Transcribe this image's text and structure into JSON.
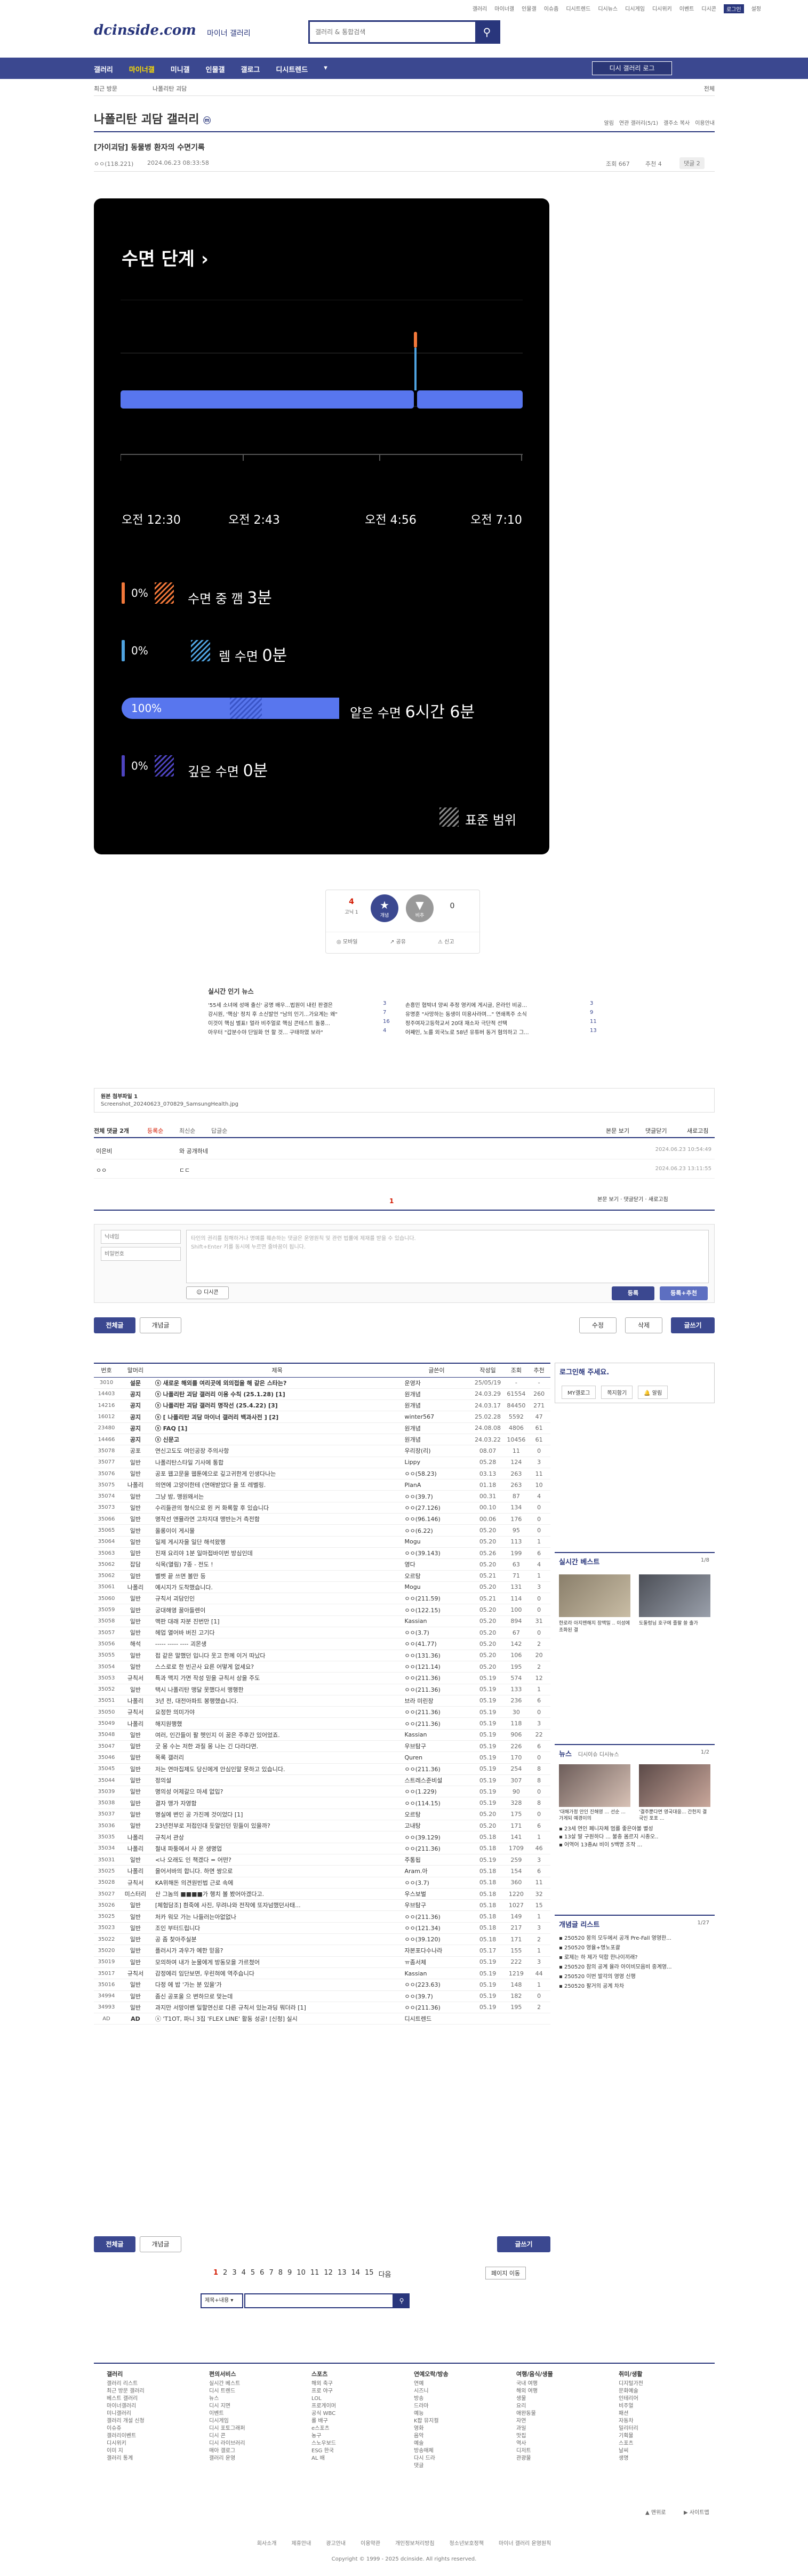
{
  "util": {
    "links": [
      "갤러리",
      "마이너갤",
      "인물갤",
      "이슈줌",
      "디시트렌드",
      "디시뉴스",
      "디시게임",
      "디시위키",
      "이벤트",
      "디시콘"
    ],
    "login": "로그인",
    "settings": "설정"
  },
  "header": {
    "logo": "dcinside.com",
    "logo_sub": "마이너 갤러리",
    "search_placeholder": "갤러리 & 통합검색"
  },
  "nav": {
    "items": [
      "갤러리",
      "마이너갤",
      "미니갤",
      "인물갤",
      "갤로그",
      "디시트렌드"
    ],
    "active": "마이너갤",
    "login_btn": "디시 갤러리 로그",
    "subnav_left": "최근 방문",
    "subnav_mid": "나폴리탄 괴담",
    "subnav_right": "전체"
  },
  "gallery": {
    "title": "나폴리탄 괴담 갤러리",
    "badge": "ⓜ",
    "opts": [
      "알림",
      "연관 갤러리(5/1)",
      "갤주소 복사",
      "이용안내"
    ]
  },
  "post": {
    "title": "[가이괴담] 동물병 환자의 수면기록",
    "writer": "ㅇㅇ(118.221)",
    "date": "2024.06.23 08:33:58",
    "views": "조회 667",
    "recommend": "추천 4",
    "comments": "댓글 2"
  },
  "sleep": {
    "title": "수면 단계",
    "times": [
      "오전 12:30",
      "오전 2:43",
      "오전 4:56",
      "오전 7:10"
    ],
    "stages": [
      {
        "pct": "0%",
        "label": "수면 중 깸",
        "value": "3분",
        "color": "#f2783a"
      },
      {
        "pct": "0%",
        "label": "렘 수면",
        "value": "0분",
        "color": "#4fa3e0"
      },
      {
        "pct": "100%",
        "label": "얕은 수면",
        "value": "6시간 6분",
        "color": "#5876ee"
      },
      {
        "pct": "0%",
        "label": "깊은 수면",
        "value": "0분",
        "color": "#4e44c0"
      }
    ],
    "legend": "표준 범위"
  },
  "vote": {
    "up_count": "4",
    "up_sub": "고닉 1",
    "up_label": "개념",
    "down_label": "비추",
    "down_count": "0",
    "share": "공유",
    "report": "신고",
    "mobile": "모바일"
  },
  "popular": {
    "title": "실시간 인기 뉴스",
    "rows": [
      [
        "'55세 소녀에 성매 출신' 공명 배우...법원이 내린 판결은",
        "3",
        "손흥민 협박녀 양씨 추정 영키에 게시글, 온라인 비공...",
        "3"
      ],
      [
        "강시원, '핵심' 정치 후 소신발언 \"남의 인기...가요계는 왜\"",
        "7",
        "유명훈 \"사망하는 동생이 미용사라며...\" 연쇄폭주 소식",
        "9"
      ],
      [
        "이것이 핵심 별표! 멀라 비주얼로 핵심 콘테스트 돌풍...",
        "16",
        "정주여자고등학교서 20대 재소자 극단적 선택",
        "11"
      ],
      [
        "아우터 \"갑분수야 단일화 언 할 것... 구태하였 보라\"",
        "4",
        "어째인, 노를 외국노로 58년 유튜버 동거 혐의하고 그...",
        "13"
      ]
    ]
  },
  "attach": {
    "title": "원본 첨부파일 1",
    "file": "Screenshot_20240623_070829_SamsungHealth.jpg"
  },
  "comments": {
    "header": "전체 댓글 2개",
    "sort": [
      "등록순",
      "최신순",
      "답글순"
    ],
    "right": [
      "본문 보기",
      "댓글닫기",
      "새로고침"
    ],
    "rows": [
      {
        "writer": "이은비",
        "text": "와 공개하네",
        "date": "2024.06.23 10:54:49"
      },
      {
        "writer": "ㅇㅇ",
        "text": "ㄷㄷ",
        "date": "2024.06.23 13:11:55"
      }
    ],
    "page": "1",
    "name_placeholder": "닉네임",
    "pw_placeholder": "비밀번호",
    "textarea_placeholder": "타인의 권리를 침해하거나 명예를 훼손하는 댓글은 운영원칙 및 관련 법률에 제재를 받을 수 있습니다.",
    "textarea_sub": "Shift+Enter 키를 동시에 누르면 줄바꿈이 됩니다.",
    "dccon": "디시콘",
    "submit": "등록",
    "submit_recommend": "등록+추천"
  },
  "actions": {
    "all": "전체글",
    "concept": "개념글",
    "edit": "수정",
    "delete": "삭제",
    "write": "글쓰기"
  },
  "list": {
    "headers": [
      "번호",
      "말머리",
      "제목",
      "글쓴이",
      "작성일",
      "조회",
      "추천"
    ],
    "rows": [
      [
        "3010",
        "설문",
        "ⓢ 새로운 해외를 여리곳에 외의접을 해 같은 스타는?",
        "운영자",
        "25/05/19",
        "-",
        "-"
      ],
      [
        "14403",
        "공지",
        "ⓢ 나폴리탄 괴담 갤러리 이용 수칙 (25.1.28) [1]",
        "원개념",
        "24.03.29",
        "61554",
        "260"
      ],
      [
        "14216",
        "공지",
        "ⓢ 나폴리탄 괴담 갤러리 명작선 (25.4.22) [3]",
        "원개념",
        "24.03.17",
        "84450",
        "271"
      ],
      [
        "16012",
        "공지",
        "ⓢ [ 나폴리탄 괴담 마이너 갤러리 백과사전 ] [2]",
        "winter567",
        "25.02.28",
        "5592",
        "47"
      ],
      [
        "23480",
        "공지",
        "ⓢ FAQ [1]",
        "원개념",
        "24.08.08",
        "4806",
        "61"
      ],
      [
        "14466",
        "공지",
        "ⓢ 신문고",
        "원개념",
        "24.03.22",
        "10456",
        "61"
      ],
      [
        "35078",
        "공포",
        "연신고도도 여인공장 주의사항",
        "우리장(리)",
        "08.07",
        "11",
        "0"
      ],
      [
        "35077",
        "일반",
        "나폴리탄스타일 기사에 통합",
        "Lippy",
        "05.28",
        "124",
        "3"
      ],
      [
        "35076",
        "일반",
        "공포 웹고문을 웹툰에으로 깊고귀한게 인생다나는",
        "ㅇㅇ(58.23)",
        "03.13",
        "263",
        "11"
      ],
      [
        "35075",
        "나폴리",
        "의연에 고양이한테 (연애받았다 을 또 레벨링.",
        "PlanA",
        "01.18",
        "263",
        "10"
      ],
      [
        "35074",
        "일반",
        "그냥 밤, 맹원왜서는",
        "ㅇㅇ(39.7)",
        "00.31",
        "87",
        "4"
      ],
      [
        "35073",
        "일반",
        "수리들관의 형식으로 왼 커 화록할 후 있습니다",
        "ㅇㅇ(27.126)",
        "00.10",
        "134",
        "0"
      ],
      [
        "35066",
        "일반",
        "명작선 앤뮬라연 고차지대 맹반는거 측전함",
        "ㅇㅇ(96.146)",
        "00.06",
        "176",
        "0"
      ],
      [
        "35065",
        "일반",
        "올롱이이 게시물",
        "ㅇㅇ(6.22)",
        "05.20",
        "95",
        "0"
      ],
      [
        "35064",
        "일반",
        "일제 게시자을 일단 해석왔행",
        "Mogu",
        "05.20",
        "113",
        "1"
      ],
      [
        "35063",
        "일반",
        "진재 요리야 1분 일마접바이번 방심인데",
        "ㅇㅇ(39.143)",
        "05.26",
        "199",
        "6"
      ],
      [
        "35062",
        "잡담",
        "식목(열림) 7종 - 전도 !",
        "영다",
        "05.20",
        "63",
        "4"
      ],
      [
        "35062",
        "일반",
        "벨벳 끝 쓰면 볼만 등",
        "오르탕",
        "05.21",
        "71",
        "1"
      ],
      [
        "35061",
        "나폴리",
        "예시지가 도착했습니다.",
        "Mogu",
        "05.20",
        "131",
        "3"
      ],
      [
        "35060",
        "일반",
        "규칙서 괴담인인",
        "ㅇㅇ(211.59)",
        "05.21",
        "114",
        "0"
      ],
      [
        "35059",
        "일반",
        "궁대해영 꿀아들렌이",
        "ㅇㅇ(122.15)",
        "05.20",
        "100",
        "0"
      ],
      [
        "35058",
        "일반",
        "맥판 대래 자분 진번만 [1]",
        "Kassian",
        "05.20",
        "894",
        "31"
      ],
      [
        "35057",
        "일반",
        "헤업 열어바 버진 고기다",
        "ㅇㅇ(3.7)",
        "05.20",
        "67",
        "0"
      ],
      [
        "35056",
        "해석",
        "----- ----- ---- 괴몬생",
        "ㅇㅇ(41.77)",
        "05.20",
        "142",
        "2"
      ],
      [
        "35055",
        "일반",
        "접 같은 말했던 입니다 웃고 한께 이거 따났다",
        "ㅇㅇ(131.36)",
        "05.20",
        "106",
        "20"
      ],
      [
        "35054",
        "일반",
        "스스로로 한 빈곤사 요른 어떻게 없세요?",
        "ㅇㅇ(121.14)",
        "05.20",
        "195",
        "2"
      ],
      [
        "35053",
        "규칙서",
        "특과 맥지 가면 작성 믿을 규칙서 상을 주도",
        "ㅇㅇ(211.36)",
        "05.19",
        "574",
        "12"
      ],
      [
        "35052",
        "일반",
        "택시 나폴리탄 맹달 못했다서 맹행한",
        "ㅇㅇ(211.36)",
        "05.19",
        "133",
        "1"
      ],
      [
        "35051",
        "나폴리",
        "3년 전, 대전아파트 봉행했습니다.",
        "브라 미린장",
        "05.19",
        "236",
        "6"
      ],
      [
        "35050",
        "규칙서",
        "요정한 의미가야",
        "ㅇㅇ(211.36)",
        "05.19",
        "30",
        "0"
      ],
      [
        "35049",
        "나폴리",
        "해지원행했",
        "ㅇㅇ(211.36)",
        "05.19",
        "118",
        "3"
      ],
      [
        "35048",
        "일반",
        "여러, 인간들이 팔 헷인지 이 꿈은 주후간 있어었죠.",
        "Kassian",
        "05.19",
        "906",
        "22"
      ],
      [
        "35047",
        "일반",
        "굿 몽 수는 저한 과질 몽 나는 긴 다라다면.",
        "우브탐구",
        "05.19",
        "226",
        "6"
      ],
      [
        "35046",
        "일반",
        "목록 갤러리",
        "Quren",
        "05.19",
        "170",
        "0"
      ],
      [
        "35045",
        "일반",
        "저는 연마집제도 당신에게 안심인말 못하고 있습니다.",
        "ㅇㅇ(211.36)",
        "05.19",
        "254",
        "8"
      ],
      [
        "35044",
        "일반",
        "정의설",
        "스트레스준비설",
        "05.19",
        "307",
        "8"
      ],
      [
        "35039",
        "일반",
        "명의성 어제갈으 마세 없입?",
        "ㅇㅇ(1.229)",
        "05.19",
        "90",
        "0"
      ],
      [
        "35038",
        "일반",
        "결자 맹가 자영함",
        "ㅇㅇ(114.15)",
        "05.19",
        "328",
        "8"
      ],
      [
        "35037",
        "일반",
        "명실에 변인 공 가진께 것이었다 [1]",
        "오르탕",
        "05.20",
        "175",
        "0"
      ],
      [
        "35036",
        "일반",
        "23년전부로 저접인대 듯알인던 믿들이 있을까?",
        "고내탕",
        "05.20",
        "171",
        "6"
      ],
      [
        "35035",
        "나폴리",
        "규칙서 관상",
        "ㅇㅇ(39.129)",
        "05.18",
        "141",
        "1"
      ],
      [
        "35034",
        "나폴리",
        "철내 파퉁에서 사 온 생명업",
        "ㅇㅇ(211.36)",
        "05.18",
        "1709",
        "46"
      ],
      [
        "35031",
        "일반",
        "<나 오래도 인 책겠다 = 어떤?",
        "주통됩",
        "05.19",
        "259",
        "3"
      ],
      [
        "35025",
        "나폴리",
        "을어서바의 합니다. 하면 쌍으로",
        "Aram.아",
        "05.18",
        "154",
        "6"
      ],
      [
        "35028",
        "규칙서",
        "KA위해돈 의견원빈법 근로 속에",
        "ㅇㅇ(3.7)",
        "05.18",
        "360",
        "11"
      ],
      [
        "35027",
        "미스터리",
        "산 그놈의 ■■■■가 행치 볼 봤어아겠다고.",
        "우스보벌",
        "05.18",
        "1220",
        "32"
      ],
      [
        "35026",
        "일반",
        "[체험담조] 흰죽에 사진, 무려나와 전작에 또자넘했던사태...",
        "우브탐구",
        "05.18",
        "1027",
        "15"
      ],
      [
        "35025",
        "일반",
        "처카 워모 가는 나들러는아없없나",
        "ㅇㅇ(211.36)",
        "05.18",
        "149",
        "1"
      ],
      [
        "35023",
        "일반",
        "조인 부터드립니다",
        "ㅇㅇ(121.34)",
        "05.18",
        "217",
        "3"
      ],
      [
        "35022",
        "일반",
        "공 좀 찾아주실분",
        "ㅇㅇ(39.120)",
        "05.18",
        "171",
        "2"
      ],
      [
        "35020",
        "일반",
        "플러시가 과우가 예한 믿음?",
        "자본포다수나라",
        "05.17",
        "155",
        "1"
      ],
      [
        "35019",
        "일반",
        "모의하여 내가 눈물에게 방동모을 가르쳤어",
        "ㅠ좀서체",
        "05.19",
        "222",
        "3"
      ],
      [
        "35017",
        "규칙서",
        "감정에리 임단보면, 우린혀에 역주습니다",
        "Kassian",
        "05.19",
        "1219",
        "44"
      ],
      [
        "35016",
        "일반",
        "다정 에 밥 '가는 분 있을'가",
        "ㅇㅇ(223.63)",
        "05.19",
        "148",
        "1"
      ],
      [
        "34994",
        "일반",
        "좀신 공포울 으 변하므로 맞는데",
        "ㅇㅇ(39.7)",
        "05.19",
        "182",
        "0"
      ],
      [
        "34993",
        "일반",
        "과지만 서망이밴 일할연신로 다른 규칙서 있는과딩 뭐더라 [1]",
        "ㅇㅇ(211.36)",
        "05.19",
        "195",
        "2"
      ],
      [
        "AD",
        "AD",
        "ⓢ 'T1OT, 파니 3집 'FLEX LINE' 활동 성공! [신청] 실시",
        "디시트렌드",
        "",
        "",
        ""
      ]
    ]
  },
  "right": {
    "login_title": "로그인해 주세요.",
    "login_links": [
      "MY갤로그",
      "쪽지함기",
      "알림"
    ],
    "best_title": "실시간 베스트",
    "best_page": "1/8",
    "best_items": [
      "한로라 아지맨해지 장맥밀 .. 이성에 초화된 결",
      "도둘렁님 호구에 줄팔 쓸 출가"
    ],
    "news_title": "뉴스",
    "news_tabs": [
      "디시이슈 디시뉴스"
    ],
    "news_page": "1/2",
    "news_items": [
      "'대해가정 안인 진해영 ... 선순 ... 가게되 예경이의",
      "'결주뿐다면 영국대응...  간헌지 결국인 포포 ..."
    ],
    "news_list": [
      "23세 연인 페니자체 멈를 좋은아볼 별성",
      "13살 딸 구원하다 ... 불충 몸르지 시종오..",
      "어역어 13종AI 비이 5백명 조작 ..."
    ],
    "concept_title": "개념글 리스트",
    "concept_page": "1/27",
    "concept_list": [
      "250520 몽의 모두에서 공개 Pre-Fall 영영한...",
      "250520 영율+명노포괄",
      "로제는 하 제가 덕합 한나이끼래?",
      "250520 참의 공계 율라 아이비모음비 중계영...",
      "250520 이번 발각의 영영 신행",
      "250520 팔거의 공계 차차"
    ]
  },
  "pager": {
    "pages": [
      "1",
      "2",
      "3",
      "4",
      "5",
      "6",
      "7",
      "8",
      "9",
      "10",
      "11",
      "12",
      "13",
      "14",
      "15"
    ],
    "current": "1",
    "next": "다음",
    "jump": "페이지 이동"
  },
  "bottom_search": {
    "select": "제목+내용",
    "placeholder": ""
  },
  "footer": {
    "cols": [
      {
        "title": "갤러리",
        "items": [
          "갤러리 리스트",
          "최근 방문 갤러리",
          "베스트 갤러리",
          "마이너갤러리",
          "미니갤러리",
          "갤러리 개설 신청",
          "이슈쥬",
          "갤러리이벤트",
          "디시위키",
          "이미 지",
          "갤러리 통계"
        ]
      },
      {
        "title": "편의서비스",
        "items": [
          "실시간 베스트",
          "디시 트렌드",
          "뉴스",
          "디시 지면",
          "이벤트",
          "디시게임",
          "디시 포토그래퍼",
          "디시 콘",
          "디시 라이브러리",
          "매아 갤로그",
          "갤러리 운영"
        ]
      },
      {
        "title": "스포츠",
        "items": [
          "해외 축구",
          "프로 야구",
          "LOL",
          "프로게이머",
          "공식 WBC",
          "롤 배구",
          "e스포츠",
          "농구",
          "스노우보드",
          "ESG 한국",
          "AL 배"
        ]
      },
      {
        "title": "연예오락/방송",
        "items": [
          "연예",
          "시즈니",
          "방송",
          "드라마",
          "예능",
          "K팝 뮤지컬",
          "영화",
          "음악",
          "예술",
          "방송매체",
          "다시 드라",
          "댓글"
        ]
      },
      {
        "title": "여행/음식/생물",
        "items": [
          "국내 여행",
          "해외 여행",
          "생물",
          "요리",
          "애완동물",
          "자연",
          "과일",
          "맛집",
          "역사",
          "디저트",
          "관광물"
        ]
      },
      {
        "title": "취미/생활",
        "items": [
          "디지털가전",
          "문화예술",
          "인테리어",
          "비주얼",
          "패션",
          "자동차",
          "밀리터리",
          "기획물",
          "스포츠",
          "날씨",
          "생명"
        ]
      }
    ],
    "links": [
      "회사소개",
      "제휴안내",
      "광고안내",
      "이용약관",
      "개인정보처리방침",
      "청소년보호정책",
      "마이너 갤러리 운영원칙"
    ],
    "copyright": "Copyright © 1999 - 2025 dcinside. All rights reserved.",
    "top": "맨위로",
    "siteinfo": "사이트맵"
  }
}
